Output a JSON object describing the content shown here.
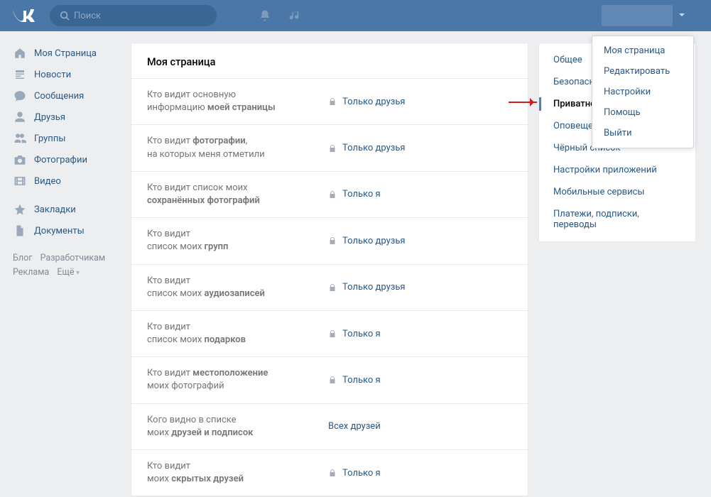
{
  "search_placeholder": "Поиск",
  "nav": {
    "items": [
      {
        "icon": "home",
        "label": "Моя Страница"
      },
      {
        "icon": "news",
        "label": "Новости"
      },
      {
        "icon": "chat",
        "label": "Сообщения"
      },
      {
        "icon": "user",
        "label": "Друзья"
      },
      {
        "icon": "users",
        "label": "Группы"
      },
      {
        "icon": "camera",
        "label": "Фотографии"
      },
      {
        "icon": "video",
        "label": "Видео"
      }
    ],
    "items2": [
      {
        "icon": "star",
        "label": "Закладки"
      },
      {
        "icon": "doc",
        "label": "Документы"
      }
    ],
    "foot": [
      "Блог",
      "Разработчикам",
      "Реклама",
      "Ещё"
    ]
  },
  "page_title": "Моя страница",
  "settings_rows": [
    {
      "t1": "Кто видит основную",
      "t2": "информацию ",
      "b": "моей страницы",
      "val": "Только друзья",
      "lock": true
    },
    {
      "t1": "Кто видит ",
      "b1": "фотографии",
      "t1b": ",",
      "t2": "на которых меня отметили",
      "val": "Только друзья",
      "lock": true
    },
    {
      "t1": "Кто видит список моих",
      "t2b": "сохранённых фотографий",
      "val": "Только я",
      "lock": true
    },
    {
      "t1": "Кто видит",
      "t2": "список моих ",
      "b": "групп",
      "val": "Только друзья",
      "lock": true
    },
    {
      "t1": "Кто видит",
      "t2": "список моих ",
      "b": "аудиозаписей",
      "val": "Только друзья",
      "lock": true
    },
    {
      "t1": "Кто видит",
      "t2": "список моих ",
      "b": "подарков",
      "val": "Только я",
      "lock": true
    },
    {
      "t1": "Кто видит ",
      "b1": "местоположение",
      "t2": "моих фотографий",
      "val": "Только я",
      "lock": true
    },
    {
      "t1": "Кого видно в списке",
      "t2": "моих ",
      "b": "друзей и подписок",
      "val": "Всех друзей",
      "lock": false
    },
    {
      "t1": "Кто видит",
      "t2": "моих ",
      "b": "скрытых друзей",
      "val": "Только я",
      "lock": true
    }
  ],
  "tabs": [
    "Общее",
    "Безопасность",
    "Приватность",
    "Оповещения",
    "Чёрный список",
    "Настройки приложений",
    "Мобильные сервисы",
    "Платежи, подписки, переводы"
  ],
  "tabs_active_index": 2,
  "menu": [
    "Моя страница",
    "Редактировать",
    "Настройки",
    "Помощь",
    "Выйти"
  ]
}
